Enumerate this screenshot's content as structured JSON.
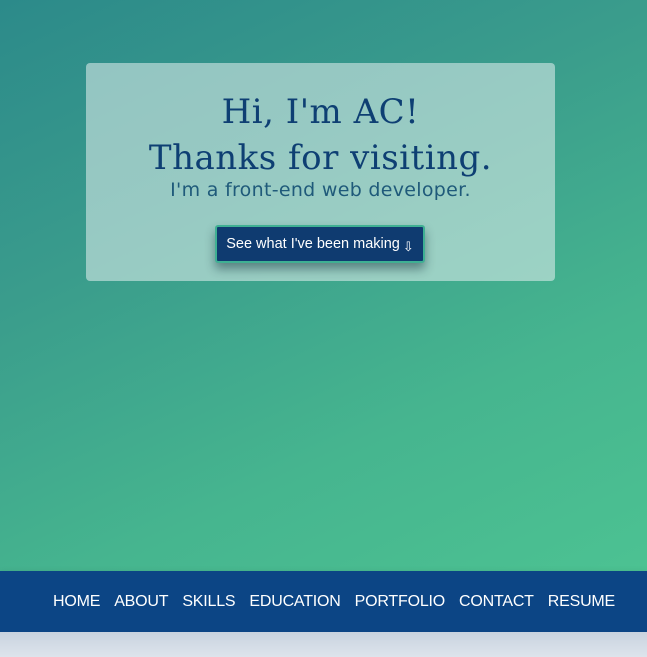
{
  "hero": {
    "greeting_line1": "Hi, I'm AC!",
    "greeting_line2": "Thanks for visiting.",
    "tagline": "I'm a front-end web developer.",
    "cta_label": "See what I've been making",
    "cta_arrow": "⇩"
  },
  "nav": {
    "items": [
      {
        "label": "HOME"
      },
      {
        "label": "ABOUT"
      },
      {
        "label": "SKILLS"
      },
      {
        "label": "EDUCATION"
      },
      {
        "label": "PORTFOLIO"
      },
      {
        "label": "CONTACT"
      },
      {
        "label": "RESUME"
      }
    ]
  },
  "colors": {
    "nav_background": "#0c4585",
    "heading": "#0e3f73",
    "button_background": "#0f3b70",
    "button_border": "#3fb093",
    "hero_gradient_start": "#2c8a8a",
    "hero_gradient_end": "#4cc292"
  }
}
